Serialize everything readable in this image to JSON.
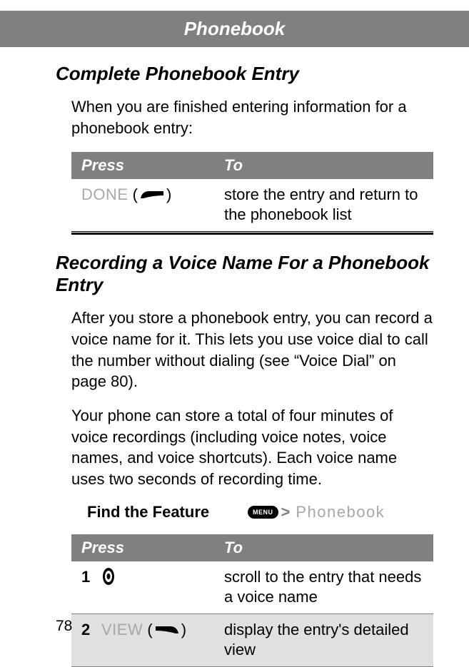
{
  "header": {
    "title": "Phonebook"
  },
  "section1": {
    "title": "Complete Phonebook Entry",
    "intro": "When you are finished entering information for a phonebook entry:",
    "table": {
      "header_press": "Press",
      "header_to": "To",
      "rows": [
        {
          "button": "DONE",
          "desc": "store the entry and return to the phonebook list"
        }
      ]
    }
  },
  "section2": {
    "title": "Recording a Voice Name For a Phonebook Entry",
    "para1": "After you store a phonebook entry, you can record a voice name for it. This lets you use voice dial to call the number without dialing (see “Voice Dial” on page 80).",
    "para2": "Your phone can store a total of four minutes of voice recordings (including voice notes, voice names, and voice shortcuts). Each voice name uses two seconds of recording time.",
    "find_feature": {
      "label": "Find the Feature",
      "menu_button": "MENU",
      "breadcrumb": "Phonebook"
    },
    "table": {
      "header_press": "Press",
      "header_to": "To",
      "rows": [
        {
          "num": "1",
          "desc": "scroll to the entry that needs a voice name"
        },
        {
          "num": "2",
          "button": "VIEW",
          "desc": "display the entry's detailed view"
        }
      ]
    }
  },
  "page_number": "78"
}
